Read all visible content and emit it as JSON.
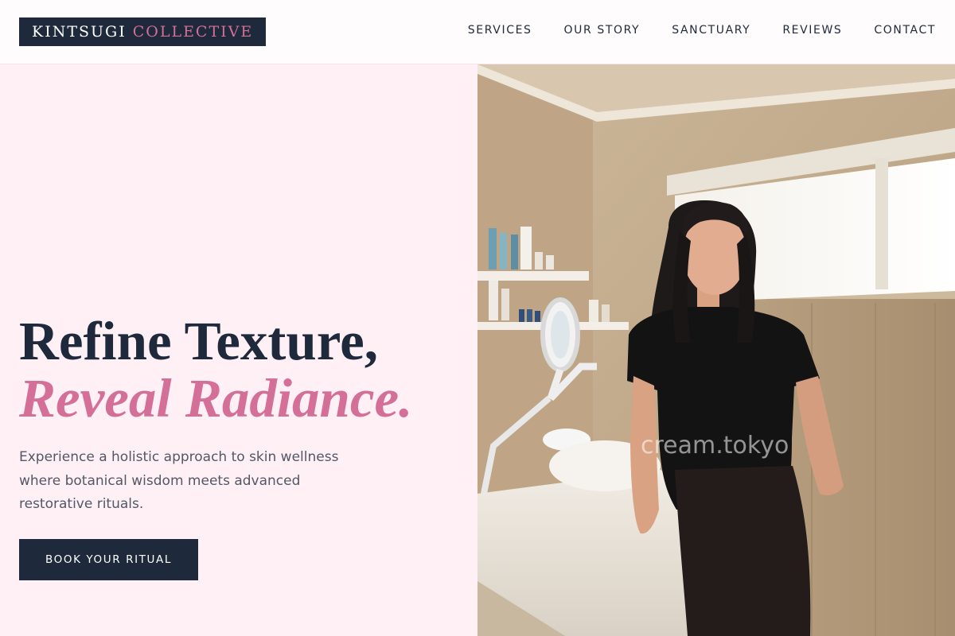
{
  "brand": {
    "word1": "KINTSUGI",
    "word2": "COLLECTIVE",
    "colors": {
      "navy": "#1e293b",
      "rose": "#d46f98",
      "blush": "#fff0f5"
    }
  },
  "nav": {
    "items": [
      {
        "label": "SERVICES"
      },
      {
        "label": "OUR STORY"
      },
      {
        "label": "SANCTUARY"
      },
      {
        "label": "REVIEWS"
      },
      {
        "label": "CONTACT"
      }
    ]
  },
  "hero": {
    "headline_line1": "Refine Texture,",
    "headline_line2": "Reveal Radiance.",
    "subtext": "Experience a holistic approach to skin wellness where botanical wisdom meets advanced restorative rituals.",
    "cta_label": "BOOK YOUR RITUAL",
    "photo_watermark": "cream.tokyo"
  }
}
